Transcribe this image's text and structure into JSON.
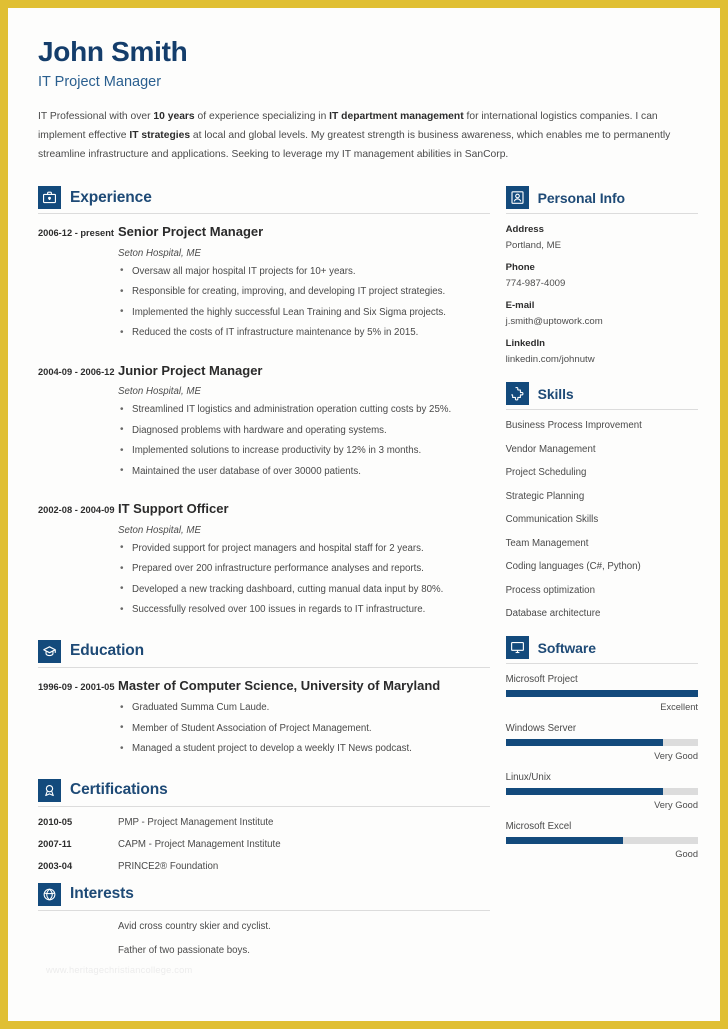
{
  "theme": {
    "border_color": "#e0bf33",
    "navy": "#134a7c",
    "heading_navy": "#1e4a76",
    "name_navy": "#143d6b",
    "bar_track": "#dcdcdc"
  },
  "header": {
    "name": "John Smith",
    "job_title": "IT Project Manager",
    "summary_parts": [
      {
        "text": "IT Professional with over ",
        "bold": false
      },
      {
        "text": "10 years",
        "bold": true
      },
      {
        "text": " of experience specializing in ",
        "bold": false
      },
      {
        "text": "IT department management",
        "bold": true
      },
      {
        "text": " for international logistics companies. I can implement effective ",
        "bold": false
      },
      {
        "text": "IT strategies",
        "bold": true
      },
      {
        "text": " at local and global levels. My greatest strength is business awareness, which enables me to permanently streamline infrastructure and applications. Seeking to leverage my IT management abilities in SanCorp.",
        "bold": false
      }
    ]
  },
  "sections": {
    "experience": {
      "title": "Experience",
      "icon": "briefcase-icon",
      "entries": [
        {
          "date": "2006-12 - present",
          "role": "Senior Project Manager",
          "org": "Seton Hospital, ME",
          "bullets": [
            "Oversaw all major hospital IT projects for 10+ years.",
            "Responsible for creating, improving, and developing IT project strategies.",
            "Implemented the highly successful Lean Training and Six Sigma projects.",
            "Reduced the costs of IT infrastructure maintenance by 5% in 2015."
          ]
        },
        {
          "date": "2004-09 - 2006-12",
          "role": "Junior Project Manager",
          "org": "Seton Hospital, ME",
          "bullets": [
            "Streamlined IT logistics and administration operation cutting costs by 25%.",
            "Diagnosed problems with hardware and operating systems.",
            "Implemented solutions to increase productivity by 12% in 3 months.",
            "Maintained the user database of over 30000 patients."
          ]
        },
        {
          "date": "2002-08 - 2004-09",
          "role": "IT Support Officer",
          "org": "Seton Hospital, ME",
          "bullets": [
            "Provided support for project managers and hospital staff for 2 years.",
            "Prepared over 200 infrastructure performance analyses and reports.",
            "Developed a new tracking dashboard, cutting manual data input by 80%.",
            "Successfully resolved over 100 issues in regards to IT infrastructure."
          ]
        }
      ]
    },
    "education": {
      "title": "Education",
      "icon": "graduation-cap-icon",
      "entries": [
        {
          "date": "1996-09 - 2001-05",
          "degree": "Master of Computer Science, University of Maryland",
          "bullets": [
            "Graduated Summa Cum Laude.",
            "Member of Student Association of Project Management.",
            "Managed a student project to develop a weekly IT News podcast."
          ]
        }
      ]
    },
    "certifications": {
      "title": "Certifications",
      "icon": "award-ribbon-icon",
      "items": [
        {
          "date": "2010-05",
          "name": "PMP - Project Management Institute"
        },
        {
          "date": "2007-11",
          "name": "CAPM - Project Management Institute"
        },
        {
          "date": "2003-04",
          "name": "PRINCE2® Foundation"
        }
      ]
    },
    "interests": {
      "title": "Interests",
      "icon": "basketball-icon",
      "items": [
        "Avid cross country skier and cyclist.",
        "Father of two passionate boys."
      ]
    },
    "personal_info": {
      "title": "Personal Info",
      "icon": "person-badge-icon",
      "fields": [
        {
          "label": "Address",
          "value": "Portland, ME"
        },
        {
          "label": "Phone",
          "value": "774-987-4009"
        },
        {
          "label": "E-mail",
          "value": "j.smith@uptowork.com"
        },
        {
          "label": "LinkedIn",
          "value": "linkedin.com/johnutw"
        }
      ]
    },
    "skills": {
      "title": "Skills",
      "icon": "puzzle-piece-icon",
      "items": [
        "Business Process Improvement",
        "Vendor Management",
        "Project Scheduling",
        "Strategic Planning",
        "Communication Skills",
        "Team Management",
        "Coding languages (C#, Python)",
        "Process optimization",
        "Database architecture"
      ]
    },
    "software": {
      "title": "Software",
      "icon": "monitor-icon",
      "items": [
        {
          "name": "Microsoft Project",
          "level": "Excellent",
          "percent": 100
        },
        {
          "name": "Windows Server",
          "level": "Very Good",
          "percent": 82
        },
        {
          "name": "Linux/Unix",
          "level": "Very Good",
          "percent": 82
        },
        {
          "name": "Microsoft Excel",
          "level": "Good",
          "percent": 61
        }
      ]
    }
  },
  "watermark": "www.heritagechristiancollege.com"
}
